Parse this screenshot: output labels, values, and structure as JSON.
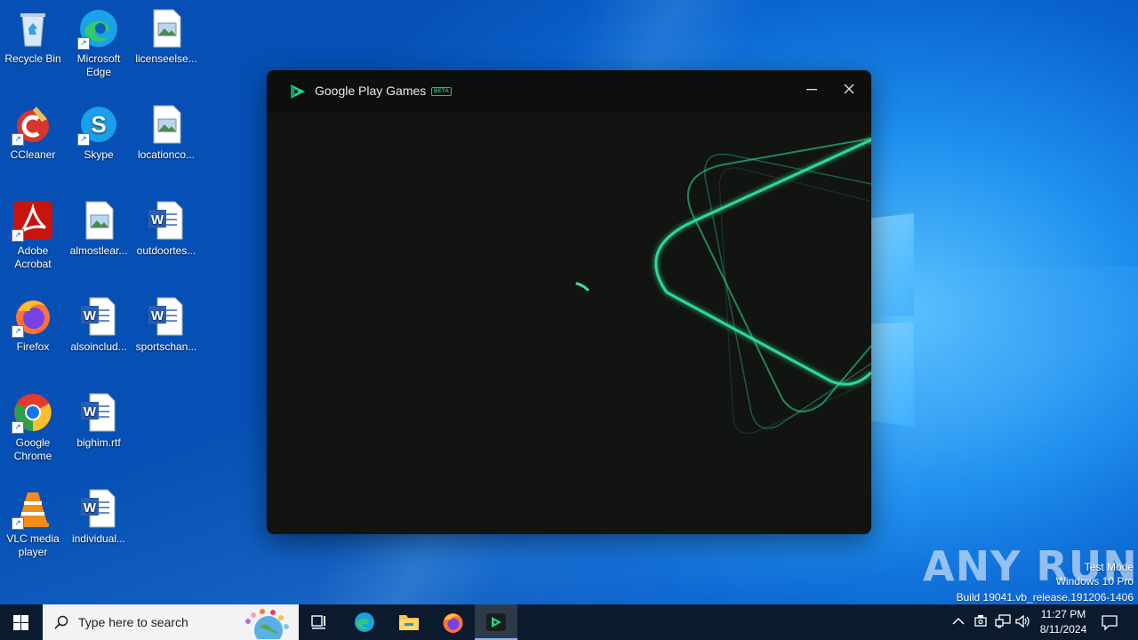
{
  "desktop": {
    "icons": [
      {
        "label": "Recycle Bin"
      },
      {
        "label": "Microsoft Edge"
      },
      {
        "label": "licenseelse..."
      },
      {
        "label": "CCleaner"
      },
      {
        "label": "Skype"
      },
      {
        "label": "locationco..."
      },
      {
        "label": "Adobe Acrobat"
      },
      {
        "label": "almostlear..."
      },
      {
        "label": "outdoortes..."
      },
      {
        "label": "Firefox"
      },
      {
        "label": "alsoinclud..."
      },
      {
        "label": "sportschan..."
      },
      {
        "label": "Google Chrome"
      },
      {
        "label": "bighim.rtf"
      },
      {
        "label": "VLC media player"
      },
      {
        "label": "individual..."
      }
    ]
  },
  "window": {
    "title": "Google Play Games",
    "badge": "BETA",
    "accent": "#2ee59d",
    "background": "#121412"
  },
  "taskbar": {
    "search_placeholder": "Type here to search",
    "apps": [
      "start-icon",
      "task-view-icon",
      "edge-icon",
      "file-explorer-icon",
      "firefox-icon",
      "google-play-games-icon"
    ],
    "active_app": "google-play-games-icon",
    "clock": {
      "time": "11:27 PM",
      "date": "8/11/2024"
    }
  },
  "watermark": {
    "line1": "Test Mode",
    "line2": "Windows 10 Pro",
    "line3": "Build 19041.vb_release.191206-1406",
    "brand": "ANY RUN"
  }
}
